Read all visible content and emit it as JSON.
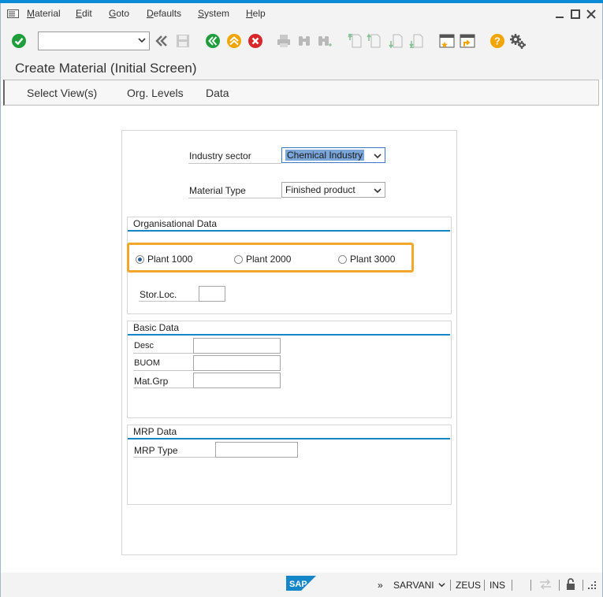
{
  "menu": {
    "items": [
      "Material",
      "Edit",
      "Goto",
      "Defaults",
      "System",
      "Help"
    ]
  },
  "toolbar": {
    "command_field_value": "",
    "icons": [
      "enter-check-icon",
      "back-chevron-icon",
      "save-icon",
      "back-icon",
      "exit-icon",
      "cancel-icon",
      "print-icon",
      "find-icon",
      "find-next-icon",
      "first-page-icon",
      "previous-page-icon",
      "next-page-icon",
      "last-page-icon",
      "new-session-icon",
      "shortcut-icon",
      "help-icon",
      "settings-icon"
    ]
  },
  "page": {
    "title": "Create Material (Initial Screen)"
  },
  "app_toolbar": {
    "select_views": "Select View(s)",
    "org_levels": "Org. Levels",
    "data": "Data"
  },
  "form": {
    "industry_sector_label": "Industry sector",
    "industry_sector_value": "Chemical Industry",
    "material_type_label": "Material Type",
    "material_type_value": "Finished product",
    "org_group_title": "Organisational Data",
    "plants": [
      {
        "label": "Plant 1000",
        "selected": true
      },
      {
        "label": "Plant 2000",
        "selected": false
      },
      {
        "label": "Plant 3000",
        "selected": false
      }
    ],
    "stor_loc_label": "Stor.Loc.",
    "stor_loc_value": "",
    "basic_group_title": "Basic Data",
    "desc_label": "Desc",
    "buom_label": "BUOM",
    "matgrp_label": "Mat.Grp",
    "mrp_group_title": "MRP Data",
    "mrp_type_label": "MRP Type"
  },
  "status": {
    "expand": "»",
    "user": "SARVANI",
    "system": "ZEUS",
    "mode": "INS"
  },
  "colors": {
    "accent_blue": "#1587c8",
    "highlight_orange": "#f2a62a",
    "green": "#1e9e3a",
    "yellow": "#f0a500",
    "red": "#d9262b"
  }
}
